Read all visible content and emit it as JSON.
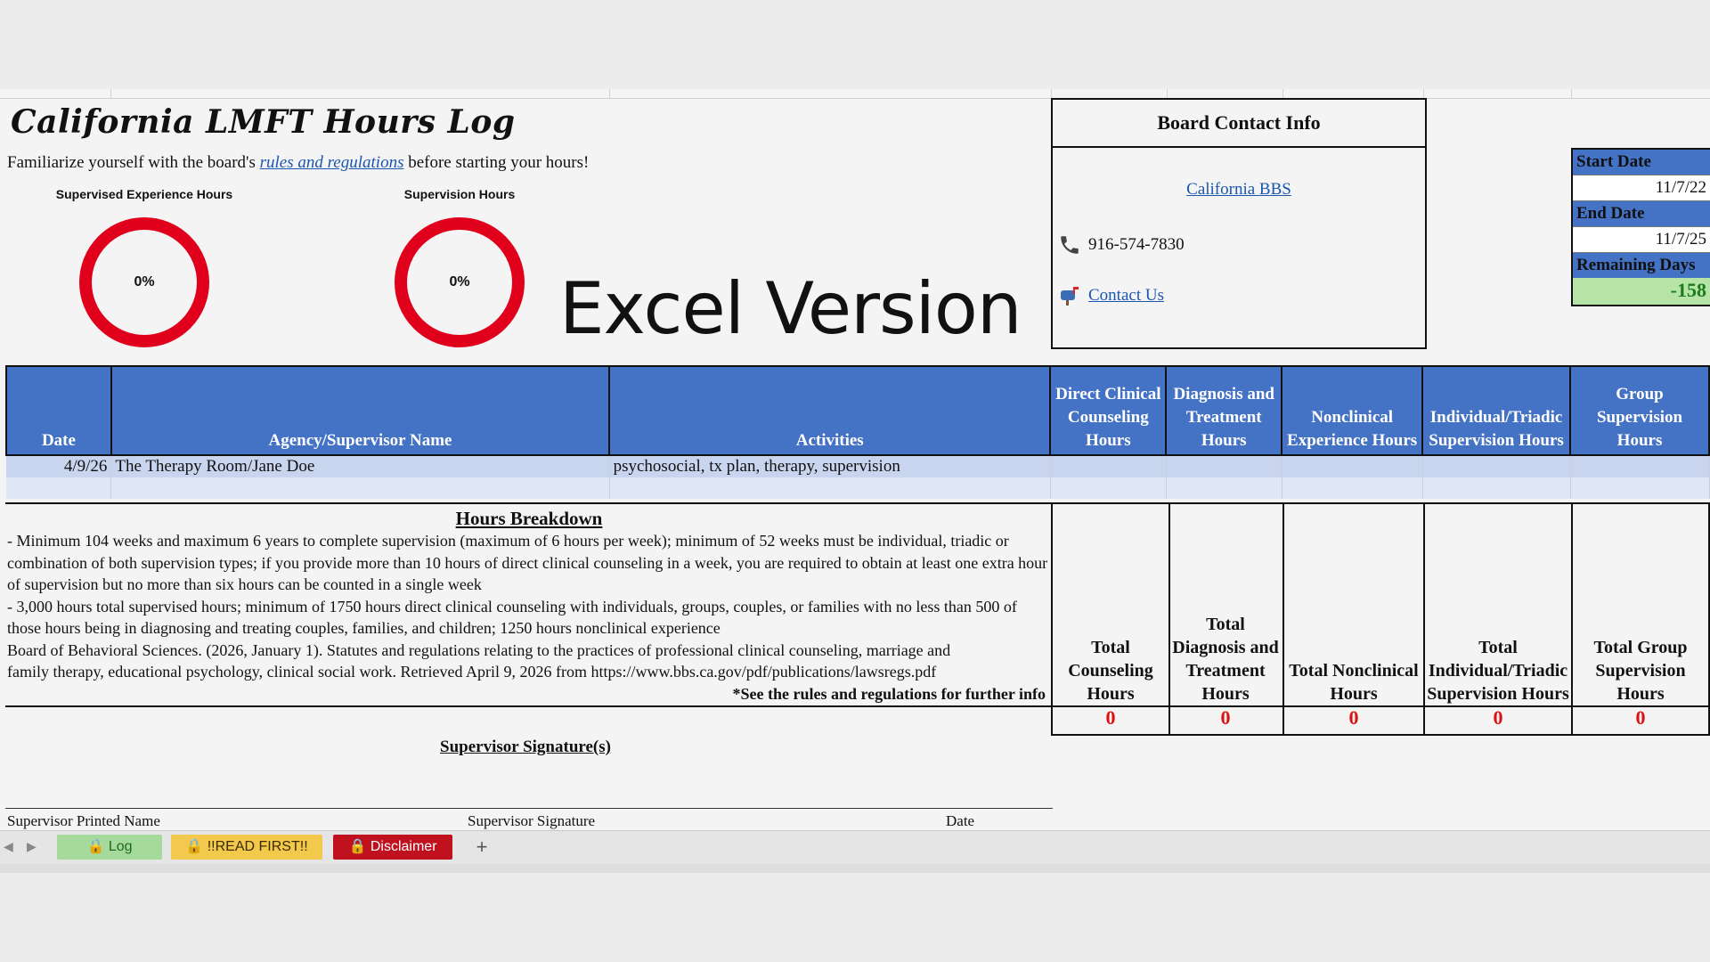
{
  "title": "California LMFT Hours Log",
  "intro": {
    "before": "Familiarize yourself with the board's",
    "link": "rules and regulations",
    "after": "before starting your hours!"
  },
  "gauges": [
    {
      "label": "Supervised Experience Hours",
      "percent": "0%",
      "color": "#e0001b"
    },
    {
      "label": "Supervision Hours",
      "percent": "0%",
      "color": "#e0001b"
    }
  ],
  "excel_version": "Excel Version",
  "board_contact": {
    "header": "Board Contact Info",
    "bbs_link": "California BBS",
    "phone": "916-574-7830",
    "phone_icon": "phone-icon",
    "contact_link": "Contact Us",
    "contact_icon": "mailbox-icon"
  },
  "dates": {
    "start_label": "Start Date",
    "start_value": "11/7/22",
    "end_label": "End Date",
    "end_value": "11/7/25",
    "remaining_label": "Remaining Days",
    "remaining_value": "-158"
  },
  "table": {
    "headers": [
      "Date",
      "Agency/Supervisor Name",
      "Activities",
      "Direct Clinical Counseling Hours",
      "Diagnosis and Treatment Hours",
      "Nonclinical Experience Hours",
      "Individual/Triadic Supervision Hours",
      "Group Supervision Hours"
    ],
    "rows": [
      [
        "4/9/26",
        "The Therapy Room/Jane Doe",
        "psychosocial, tx plan, therapy, supervision",
        "",
        "",
        "",
        "",
        ""
      ],
      [
        "",
        "",
        "",
        "",
        "",
        "",
        "",
        ""
      ]
    ]
  },
  "breakdown": {
    "heading": "Hours Breakdown",
    "line1": "- Minimum 104 weeks and maximum 6 years to complete supervision (maximum of 6 hours per week); minimum of 52 weeks must be individual, triadic or combination of both supervision types; if you provide more than 10 hours of direct clinical counseling in a week, you are required to obtain at least one extra hour of supervision but no more than six hours can be counted in a single week",
    "line2": "- 3,000 hours total supervised hours; minimum of 1750 hours direct clinical counseling with individuals, groups, couples, or families with no less than 500 of those hours being in diagnosing and treating couples, families, and children; 1250 hours nonclinical experience",
    "line3": "Board of Behavioral Sciences. (2026, January 1). Statutes and regulations relating to the practices of professional clinical counseling, marriage and family therapy, educational psychology, clinical social work. Retrieved April 9, 2026 from https://www.bbs.ca.gov/pdf/publications/lawsregs.pdf",
    "see_more": "*See the rules and regulations for further info"
  },
  "totals": {
    "labels": [
      "Total Counseling Hours",
      "Total Diagnosis and Treatment Hours",
      "Total Nonclinical Hours",
      "Total Individual/Triadic Supervision Hours",
      "Total Group Supervision Hours"
    ],
    "values": [
      "0",
      "0",
      "0",
      "0",
      "0"
    ],
    "value_color": "#d11111"
  },
  "signature": {
    "heading": "Supervisor Signature(s)",
    "printed_name": "Supervisor Printed Name",
    "signature": "Supervisor Signature",
    "date": "Date"
  },
  "tabs": {
    "items": [
      {
        "label": "Log",
        "bg": "#a6d99c",
        "fg": "#1f6b1f"
      },
      {
        "label": "!!READ FIRST!!",
        "bg": "#f2c94c",
        "fg": "#3a2b00"
      },
      {
        "label": "Disclaimer",
        "bg": "#c0111f",
        "fg": "#ffffff"
      }
    ],
    "add": "+"
  }
}
